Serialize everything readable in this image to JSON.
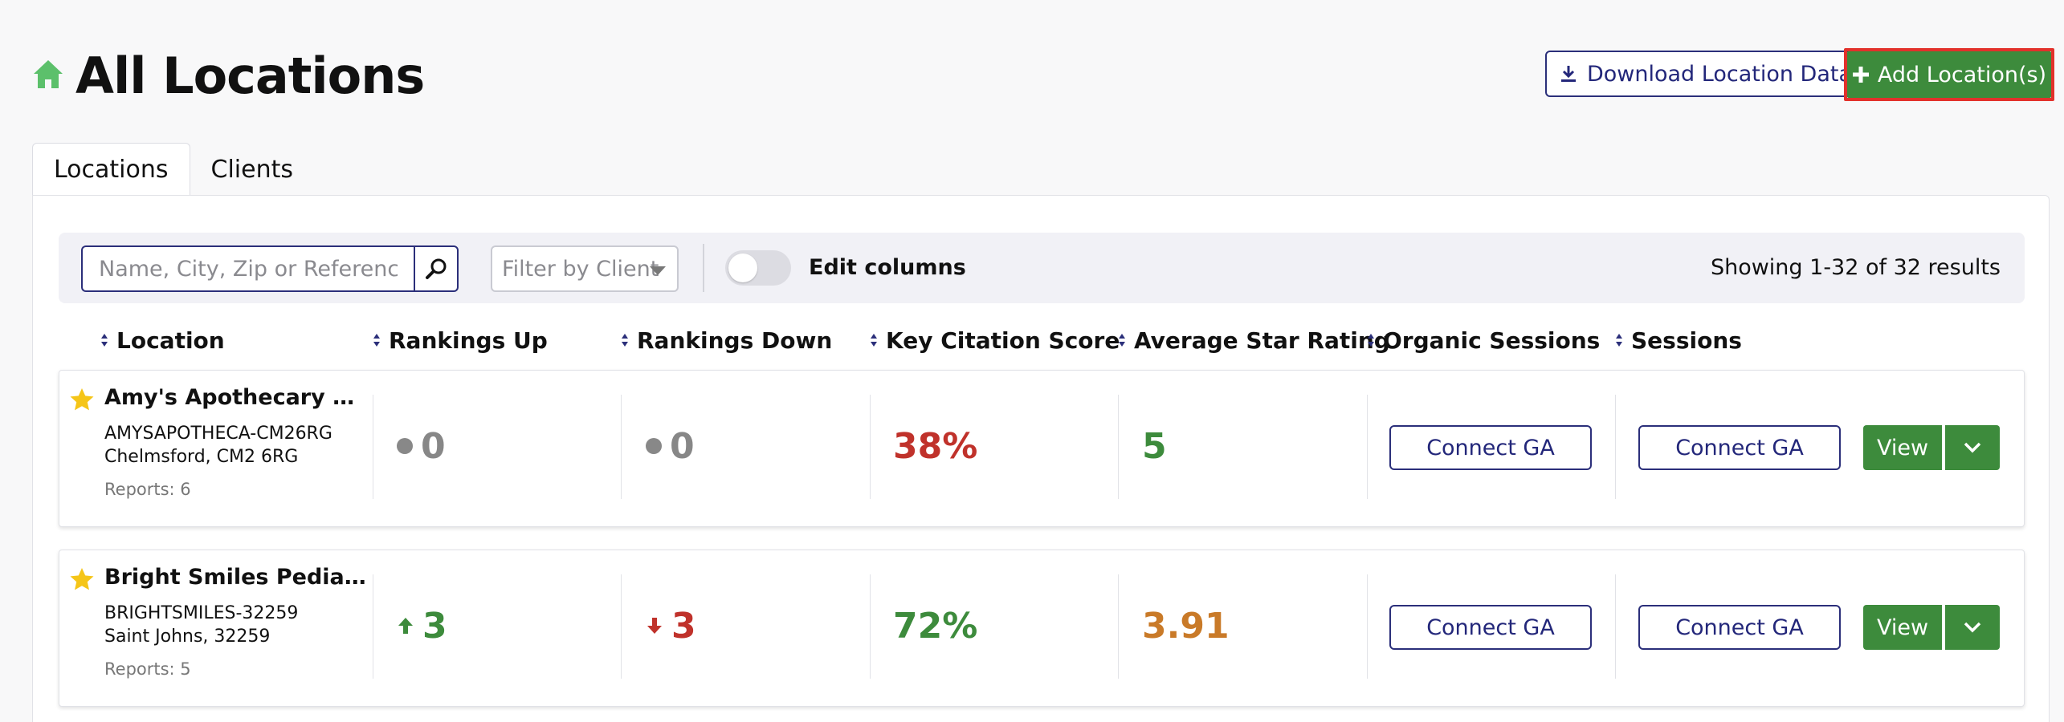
{
  "header": {
    "title": "All Locations",
    "icon": "home-icon",
    "download_label": "Download Location Data",
    "add_label": "Add Location(s)",
    "accent_green": "#3d8b3c",
    "highlight_red": "#e2312b"
  },
  "tabs": [
    {
      "label": "Locations",
      "active": true
    },
    {
      "label": "Clients",
      "active": false
    }
  ],
  "toolbar": {
    "search_placeholder": "Name, City, Zip or Reference",
    "search_value": "",
    "filter_placeholder": "Filter by Client",
    "edit_columns_label": "Edit columns",
    "edit_columns_on": false,
    "results_text": "Showing 1-32 of 32 results"
  },
  "columns": [
    "Location",
    "Rankings Up",
    "Rankings Down",
    "Key Citation Score",
    "Average Star Rating",
    "Organic Sessions",
    "Sessions"
  ],
  "rows": [
    {
      "name": "Amy's Apothecary & H...",
      "reference": "AMYSAPOTHECA-CM26RG",
      "city": "Chelmsford, CM2 6RG",
      "reports": "Reports: 6",
      "rankings_up": "0",
      "rankings_up_trend": "neutral",
      "rankings_down": "0",
      "rankings_down_trend": "neutral",
      "citation_score": "38%",
      "star_rating": "5",
      "organic_sessions_label": "Connect GA",
      "sessions_label": "Connect GA",
      "view_label": "View"
    },
    {
      "name": "Bright Smiles Pediatric...",
      "reference": "BRIGHTSMILES-32259",
      "city": "Saint Johns, 32259",
      "reports": "Reports: 5",
      "rankings_up": "3",
      "rankings_up_trend": "up",
      "rankings_down": "3",
      "rankings_down_trend": "down",
      "citation_score": "72%",
      "star_rating": "3.91",
      "organic_sessions_label": "Connect GA",
      "sessions_label": "Connect GA",
      "view_label": "View"
    }
  ]
}
